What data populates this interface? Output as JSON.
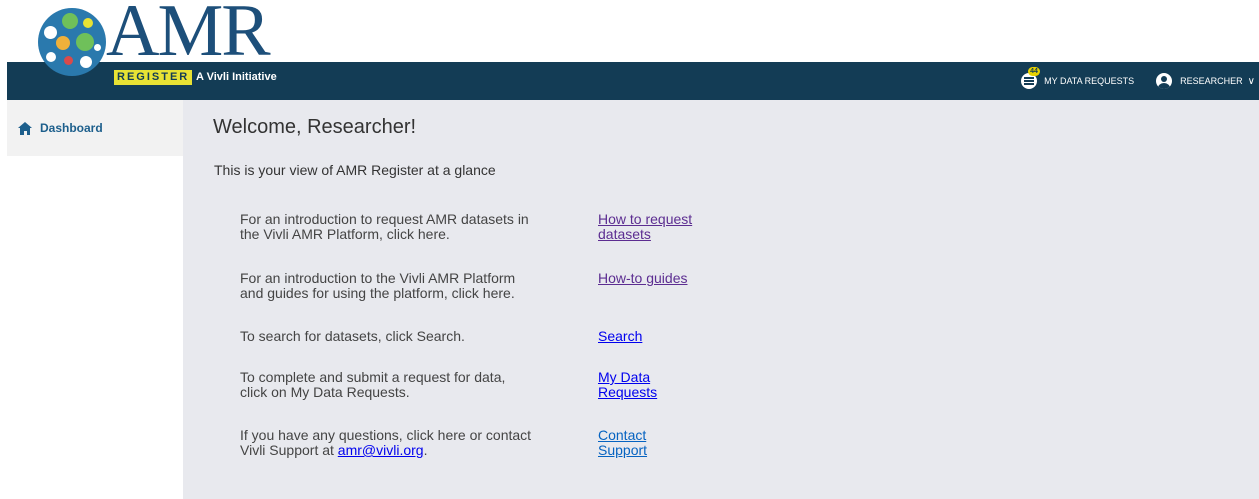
{
  "brand": {
    "logo_text": "AMR",
    "register_tag": "REGISTER",
    "initiative": "A Vivli Initiative"
  },
  "nav": {
    "requests_badge": "44",
    "requests_label": "MY DATA REQUESTS",
    "user_label": "RESEARCHER",
    "user_chevron": "∨"
  },
  "sidebar": {
    "items": [
      {
        "label": "Dashboard",
        "icon": "home-icon"
      }
    ]
  },
  "main": {
    "welcome": "Welcome, Researcher!",
    "intro": "This is your view of AMR Register at a glance",
    "rows": [
      {
        "desc_1": "For an introduction to request AMR datasets in",
        "desc_2": "the Vivli AMR Platform, click here.",
        "link_1": "How to request",
        "link_2": "datasets"
      },
      {
        "desc_1": "For an introduction to the Vivli AMR Platform",
        "desc_2": "and guides for using the platform, click here.",
        "link_1": "How-to guides",
        "link_2": ""
      },
      {
        "desc_1": "To search for datasets, click Search.",
        "desc_2": "",
        "link_1": "Search",
        "link_2": ""
      },
      {
        "desc_1": "To complete and submit a request for data,",
        "desc_2": "click on My Data Requests.",
        "link_1": "My Data",
        "link_2": "Requests"
      },
      {
        "desc_1": "If you have any questions, click here or contact",
        "desc_2_prefix": "Vivli Support at ",
        "email": "amr@vivli.org",
        "desc_2_suffix": ".",
        "link_1": "Contact",
        "link_2": "Support"
      }
    ]
  },
  "colors": {
    "navbar": "#133c55",
    "register_yellow": "#e8e234",
    "main_bg": "#e8e9ee",
    "sidebar_bg": "#f2f2f2",
    "accent": "#1d5f8c"
  }
}
